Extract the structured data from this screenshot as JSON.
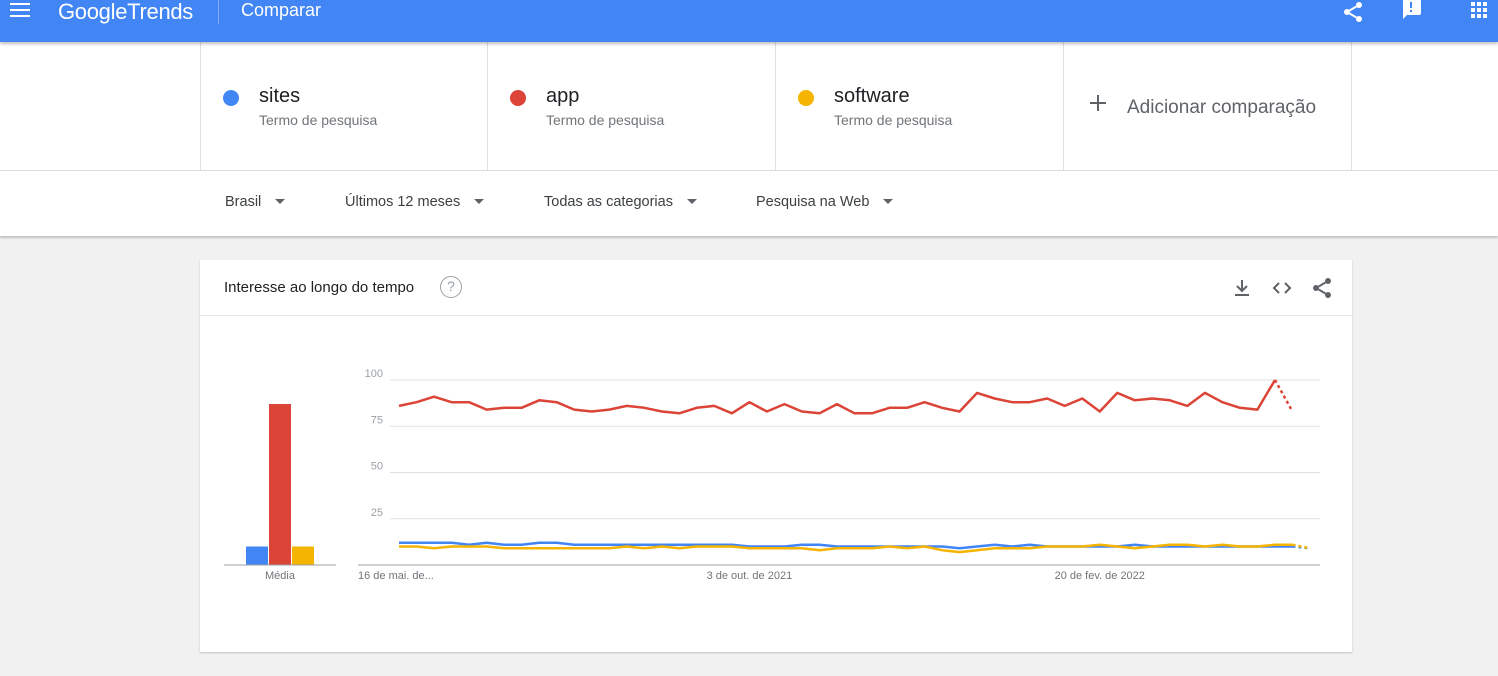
{
  "header": {
    "logo_google": "Google",
    "logo_trends": "Trends",
    "title": "Comparar",
    "icons": [
      "menu-icon",
      "share-icon",
      "feedback-icon",
      "apps-icon"
    ]
  },
  "terms": [
    {
      "name": "sites",
      "type": "Termo de pesquisa",
      "color": "#4285f4"
    },
    {
      "name": "app",
      "type": "Termo de pesquisa",
      "color": "#db4437"
    },
    {
      "name": "software",
      "type": "Termo de pesquisa",
      "color": "#f4b400"
    }
  ],
  "add_comparison": "Adicionar comparação",
  "filters": {
    "region": "Brasil",
    "period": "Últimos 12 meses",
    "category": "Todas as categorias",
    "search_type": "Pesquisa na Web"
  },
  "card": {
    "title": "Interesse ao longo do tempo",
    "help_symbol": "?",
    "icons": [
      "download-icon",
      "embed-icon",
      "share-icon"
    ]
  },
  "chart_data": {
    "type": "line",
    "average_label": "Média",
    "averages": [
      {
        "series": "sites",
        "value": 10
      },
      {
        "series": "app",
        "value": 87
      },
      {
        "series": "software",
        "value": 10
      }
    ],
    "y_ticks": [
      25,
      50,
      75,
      100
    ],
    "ylim": [
      0,
      100
    ],
    "x_tick_labels": [
      {
        "index": 0,
        "label": "16 de mai. de..."
      },
      {
        "index": 20,
        "label": "3 de out. de 2021"
      },
      {
        "index": 40,
        "label": "20 de fev. de 2022"
      }
    ],
    "partial_last_point": true,
    "series": [
      {
        "name": "sites",
        "color": "#4285f4",
        "values": [
          12,
          12,
          12,
          12,
          11,
          12,
          11,
          11,
          12,
          12,
          11,
          11,
          11,
          11,
          11,
          11,
          11,
          11,
          11,
          11,
          10,
          10,
          10,
          11,
          11,
          10,
          10,
          10,
          10,
          10,
          10,
          10,
          9,
          10,
          11,
          10,
          11,
          10,
          10,
          10,
          10,
          10,
          11,
          10,
          10,
          10,
          10,
          10,
          10,
          10,
          10,
          10,
          9
        ]
      },
      {
        "name": "app",
        "color": "#db4437",
        "values": [
          86,
          88,
          91,
          88,
          88,
          84,
          85,
          85,
          89,
          88,
          84,
          83,
          84,
          86,
          85,
          83,
          82,
          85,
          86,
          82,
          88,
          83,
          87,
          83,
          82,
          87,
          82,
          82,
          85,
          85,
          88,
          85,
          83,
          93,
          90,
          88,
          88,
          90,
          86,
          90,
          83,
          93,
          89,
          90,
          89,
          86,
          93,
          88,
          85,
          84,
          100,
          83
        ]
      },
      {
        "name": "software",
        "color": "#f4b400",
        "values": [
          10,
          10,
          9,
          10,
          10,
          10,
          9,
          9,
          9,
          9,
          9,
          9,
          9,
          10,
          9,
          10,
          9,
          10,
          10,
          10,
          9,
          9,
          9,
          9,
          8,
          9,
          9,
          9,
          10,
          9,
          10,
          8,
          7,
          8,
          9,
          9,
          9,
          10,
          10,
          10,
          11,
          10,
          9,
          10,
          11,
          11,
          10,
          11,
          10,
          10,
          11,
          11,
          9
        ]
      }
    ]
  }
}
